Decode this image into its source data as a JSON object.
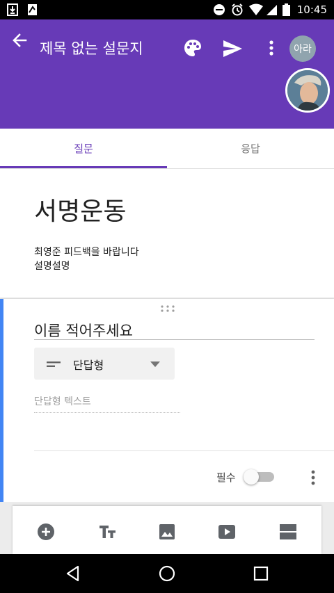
{
  "status_bar": {
    "time": "10:45",
    "left_icons": [
      "download-icon",
      "document-icon"
    ],
    "right_icons": [
      "dnd-icon",
      "alarm-icon",
      "wifi-icon",
      "signal-icon",
      "battery-icon"
    ]
  },
  "app_bar": {
    "title": "제목 없는 설문지",
    "avatar_label": "아라",
    "color": "#673ab7"
  },
  "tabs": {
    "questions": "질문",
    "responses": "응답",
    "active": "questions"
  },
  "form": {
    "heading": "서명운동",
    "description": "최영준 피드백을 바랍니다\n설명설명"
  },
  "question": {
    "title": "이름 적어주세요",
    "type_label": "단답형",
    "answer_placeholder": "단답형 텍스트",
    "required_label": "필수",
    "required": false,
    "accent_color": "#4285f4"
  },
  "toolbar": {
    "items": [
      "add-question-icon",
      "title-text-icon",
      "image-icon",
      "video-icon",
      "section-icon"
    ]
  }
}
